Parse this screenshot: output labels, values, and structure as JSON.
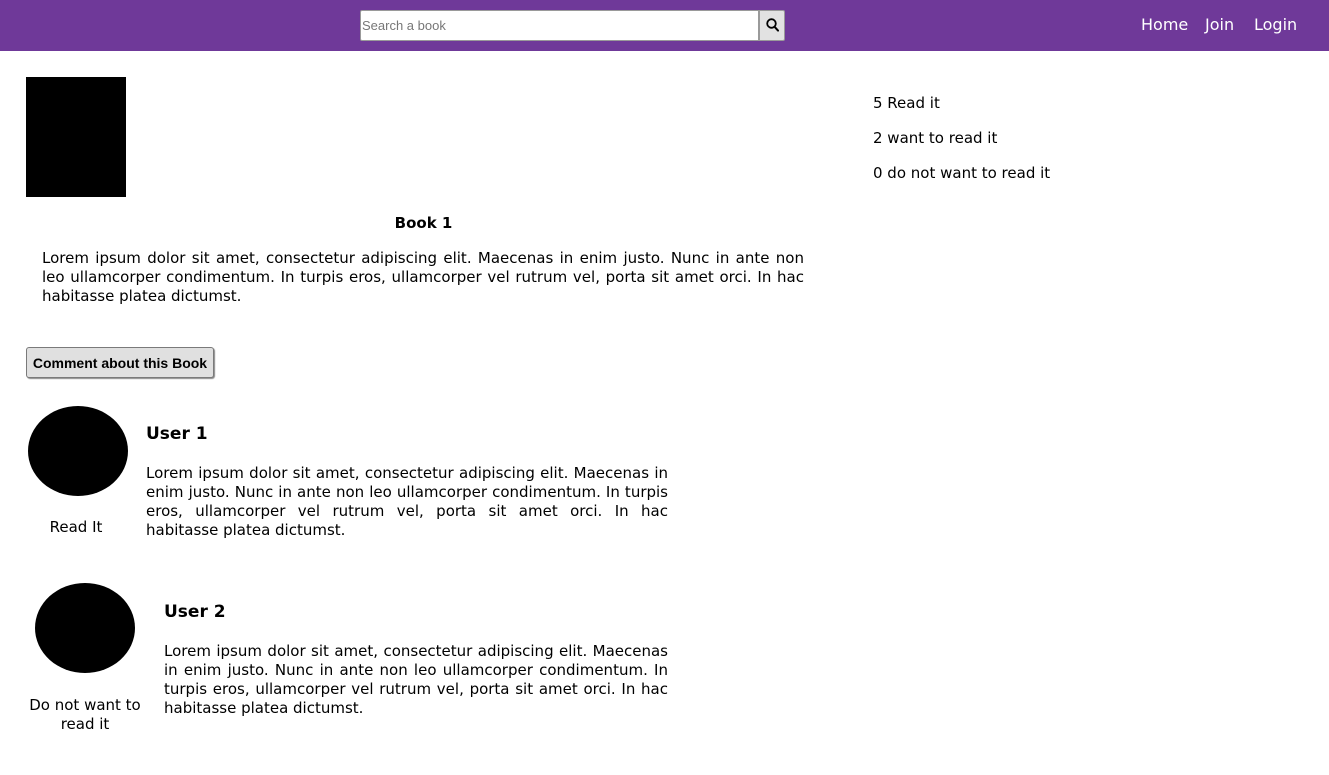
{
  "header": {
    "search_placeholder": "Search a book",
    "search_icon": "search-icon",
    "nav": [
      {
        "label": "Home"
      },
      {
        "label": "Join"
      },
      {
        "label": "Login"
      }
    ]
  },
  "book": {
    "title": "Book 1",
    "description": "Lorem ipsum dolor sit amet, consectetur adipiscing elit. Maecenas in enim justo. Nunc in ante non leo ullamcorper condimentum. In turpis eros, ullamcorper vel rutrum vel, porta sit amet orci. In hac habitasse platea dictumst."
  },
  "comment_button_label": "Comment about this Book",
  "comments": [
    {
      "user": "User 1",
      "status": "Read It",
      "text": "Lorem ipsum dolor sit amet, consectetur adipiscing elit. Maecenas in enim justo. Nunc in ante non leo ullamcorper condimentum. In turpis eros, ullamcorper vel rutrum vel, porta sit amet orci. In hac habitasse platea dictumst."
    },
    {
      "user": "User 2",
      "status": "Do not want to read it",
      "text": "Lorem ipsum dolor sit amet, consectetur adipiscing elit. Maecenas in enim justo. Nunc in ante non leo ullamcorper condimentum. In turpis eros, ullamcorper vel rutrum vel, porta sit amet orci. In hac habitasse platea dictumst."
    }
  ],
  "stats": [
    {
      "label": "5 Read it"
    },
    {
      "label": "2 want to read it"
    },
    {
      "label": "0 do not want to read it"
    }
  ],
  "colors": {
    "navbar": "#6f3999",
    "nav_text": "#ffffff"
  }
}
